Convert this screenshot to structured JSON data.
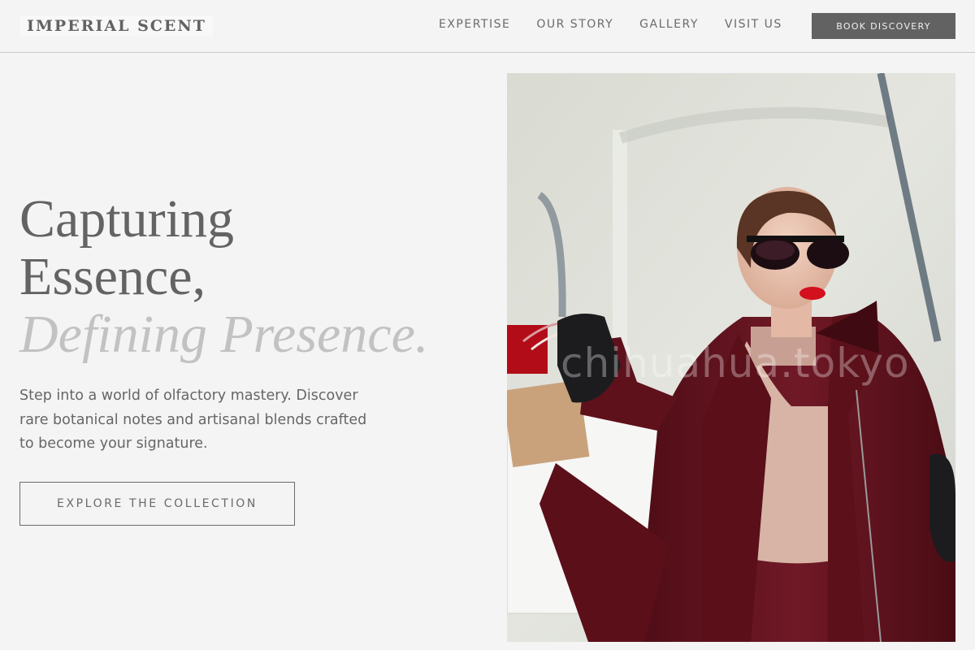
{
  "brand": {
    "name": "IMPERIAL SCENT"
  },
  "nav": {
    "items": [
      {
        "label": "EXPERTISE"
      },
      {
        "label": "OUR STORY"
      },
      {
        "label": "GALLERY"
      },
      {
        "label": "VISIT US"
      }
    ],
    "cta_label": "BOOK DISCOVERY"
  },
  "hero": {
    "headline_line1": "Capturing",
    "headline_line2": "Essence,",
    "headline_line3": "Defining Presence.",
    "description": "Step into a world of olfactory mastery. Discover rare botanical notes and artisanal blends crafted to become your signature.",
    "button_label": "EXPLORE THE COLLECTION"
  },
  "image": {
    "watermark": "chihuahua.tokyo"
  },
  "colors": {
    "background": "#f4f4f4",
    "cta_background": "#626262",
    "text_primary": "#636363",
    "text_faded": "#c2c2c2",
    "coat": "#6b1522"
  }
}
